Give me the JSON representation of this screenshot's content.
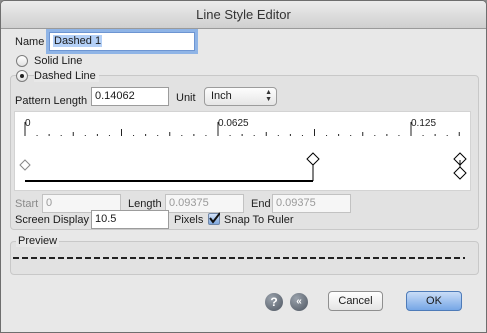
{
  "window": {
    "title": "Line Style Editor"
  },
  "name_row": {
    "label": "Name",
    "value": "Dashed 1"
  },
  "style_options": {
    "solid_label": "Solid Line",
    "dashed_label": "Dashed Line",
    "selected": "dashed"
  },
  "pattern": {
    "length_label": "Pattern Length",
    "length_value": "0.14062",
    "unit_label": "Unit",
    "unit_value": "Inch"
  },
  "ruler": {
    "tick_labels": [
      "0",
      "0.0625",
      "0.125"
    ]
  },
  "segment": {
    "start_label": "Start",
    "start_value": "0",
    "length_label": "Length",
    "length_value": "0.09375",
    "end_label": "End",
    "end_value": "0.09375"
  },
  "screen_display": {
    "label": "Screen Display",
    "value": "10.5",
    "pixels_label": "Pixels",
    "snap_label": "Snap To Ruler",
    "snap_checked": true
  },
  "preview": {
    "label": "Preview"
  },
  "buttons": {
    "help_icon": "question-icon",
    "back_icon": "double-chevron-left-icon",
    "cancel": "Cancel",
    "ok": "OK"
  },
  "colors": {
    "accent": "#76a6e6",
    "window_bg": "#e8e8e8"
  }
}
